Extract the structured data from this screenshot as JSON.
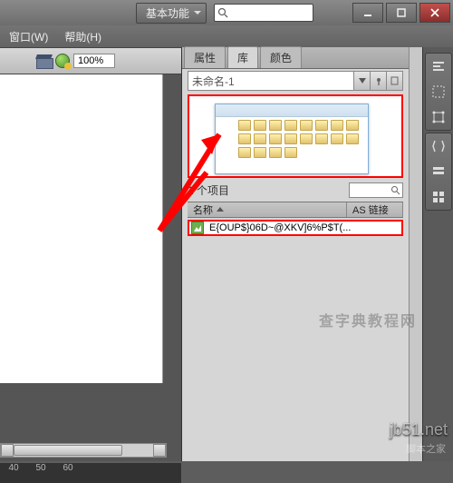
{
  "titlebar": {
    "workspace_dropdown": "基本功能",
    "search_placeholder": ""
  },
  "menubar": {
    "window": "窗口(W)",
    "help": "帮助(H)"
  },
  "left_toolbar": {
    "zoom": "100%"
  },
  "timeline": {
    "marks": [
      "40",
      "50",
      "60"
    ]
  },
  "panel": {
    "tabs": {
      "properties": "属性",
      "library": "库",
      "color": "颜色"
    },
    "doc_dropdown": "未命名-1",
    "status": "1 个项目",
    "columns": {
      "name": "名称",
      "as_link": "AS 链接"
    },
    "items": [
      {
        "filename": "E{OUP$}06D~@XKV]6%P$T(..."
      }
    ]
  },
  "watermarks": {
    "site": "jb51.net",
    "sub": "脚本之家",
    "mid": "查字典教程网"
  }
}
